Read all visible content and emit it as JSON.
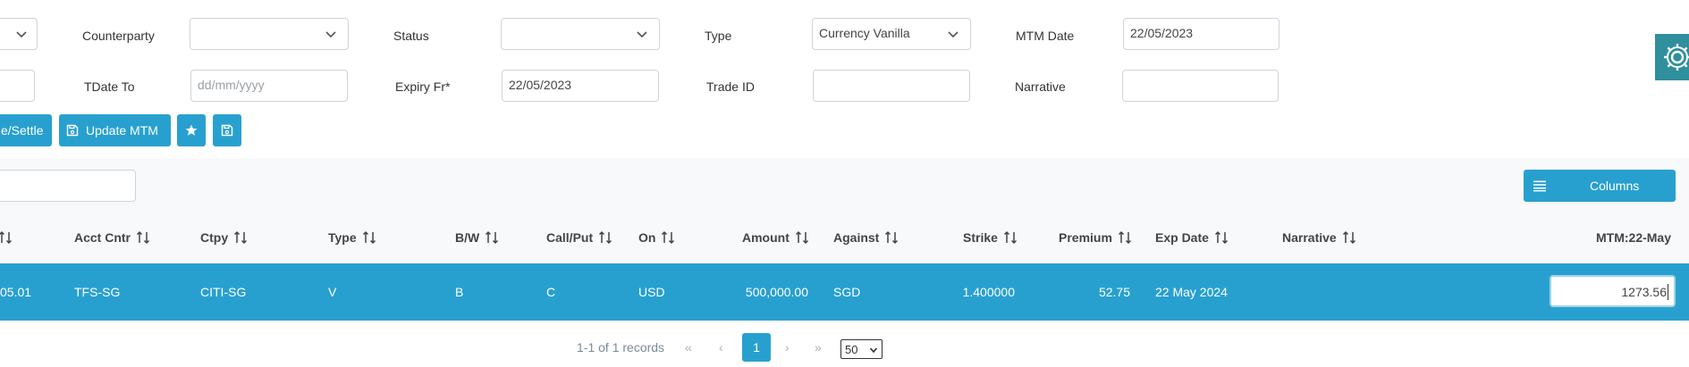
{
  "filters": {
    "counterparty_label": "Counterparty",
    "status_label": "Status",
    "type_label": "Type",
    "type_value": "Currency Vanilla",
    "mtm_date_label": "MTM Date",
    "mtm_date_value": "22/05/2023",
    "tdate_to_label": "TDate To",
    "tdate_to_placeholder": "dd/mm/yyyy",
    "expiry_fr_label": "Expiry Fr*",
    "expiry_fr_value": "22/05/2023",
    "trade_id_label": "Trade ID",
    "narrative_label": "Narrative"
  },
  "toolbar": {
    "settle_label": "e/Settle",
    "update_mtm_label": "Update MTM"
  },
  "columns_button_label": "Columns",
  "table": {
    "headers": [
      "Acct Cntr",
      "Ctpy",
      "Type",
      "B/W",
      "Call/Put",
      "On",
      "Amount",
      "Against",
      "Strike",
      "Premium",
      "Exp Date",
      "Narrative",
      "MTM:22-May"
    ],
    "row": {
      "id_fragment": "05.01",
      "acct_cntr": "TFS-SG",
      "ctpy": "CITI-SG",
      "type": "V",
      "bw": "B",
      "call_put": "C",
      "on": "USD",
      "amount": "500,000.00",
      "against": "SGD",
      "strike": "1.400000",
      "premium": "52.75",
      "exp_date": "22 May 2024",
      "narrative": "",
      "mtm": "1273.56"
    }
  },
  "pagination": {
    "records_text": "1-1 of 1 records",
    "current_page": "1",
    "page_size": "50"
  },
  "colors": {
    "accent": "#28a0cf",
    "gear_bg": "#2f8f9c"
  }
}
